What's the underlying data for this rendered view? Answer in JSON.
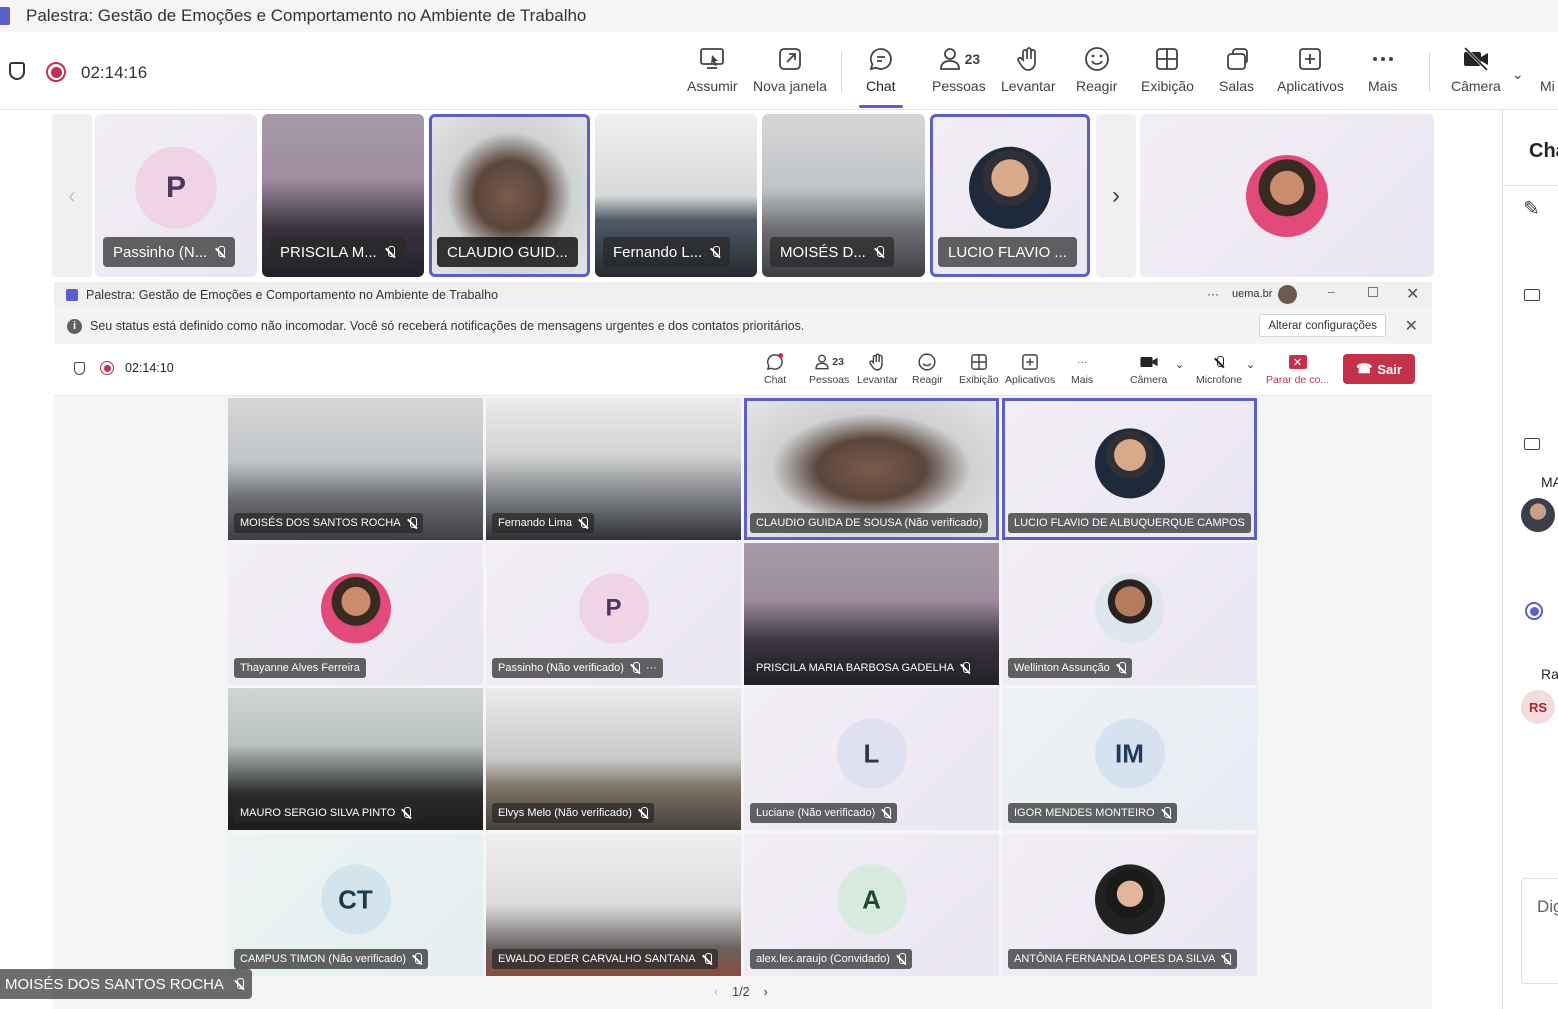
{
  "window": {
    "title": "Palestra: Gestão de Emoções e Comportamento no Ambiente de Trabalho"
  },
  "toolbar": {
    "timer": "02:14:16",
    "assumir": "Assumir",
    "nova_janela": "Nova janela",
    "chat": "Chat",
    "pessoas": "Pessoas",
    "pessoas_count": "23",
    "levantar": "Levantar",
    "reagir": "Reagir",
    "exibicao": "Exibição",
    "salas": "Salas",
    "aplicativos": "Aplicativos",
    "mais": "Mais",
    "camera": "Câmera",
    "microfone_partial": "Mi"
  },
  "strip": [
    {
      "name": "Passinho (N...",
      "initial": "P"
    },
    {
      "name": "PRISCILA M..."
    },
    {
      "name": "CLAUDIO GUID..."
    },
    {
      "name": "Fernando L..."
    },
    {
      "name": "MOISÉS D..."
    },
    {
      "name": "LUCIO FLAVIO ..."
    }
  ],
  "inner": {
    "title": "Palestra: Gestão de Emoções e Comportamento no Ambiente de Trabalho",
    "account": "uema.br",
    "banner": "Seu status está definido como não incomodar. Você só receberá notificações de mensagens urgentes e dos contatos prioritários.",
    "banner_button": "Alterar configurações",
    "timer": "02:14:10",
    "chat": "Chat",
    "pessoas": "Pessoas",
    "pessoas_count": "23",
    "levantar": "Levantar",
    "reagir": "Reagir",
    "exibicao": "Exibição",
    "aplicativos": "Aplicativos",
    "mais": "Mais",
    "camera": "Câmera",
    "microfone": "Microfone",
    "parar": "Parar de co...",
    "sair": "Sair",
    "pager": "1/2"
  },
  "grid": [
    {
      "name": "MOISÉS DOS SANTOS ROCHA"
    },
    {
      "name": "Fernando Lima"
    },
    {
      "name": "CLAUDIO GUIDA DE SOUSA (Não verificado)"
    },
    {
      "name": "LUCIO FLAVIO DE ALBUQUERQUE CAMPOS"
    },
    {
      "name": "Thayanne Alves Ferreira"
    },
    {
      "name": "Passinho (Não verificado)",
      "initial": "P"
    },
    {
      "name": "PRISCILA MARIA BARBOSA GADELHA"
    },
    {
      "name": "Wellinton Assunção"
    },
    {
      "name": "MAURO SERGIO SILVA PINTO"
    },
    {
      "name": "Elvys Melo (Não verificado)"
    },
    {
      "name": "Luciane (Não verificado)",
      "initial": "L"
    },
    {
      "name": "IGOR MENDES MONTEIRO",
      "initial": "IM"
    },
    {
      "name": "CAMPUS TIMON (Não verificado)",
      "initial": "CT"
    },
    {
      "name": "EWALDO EDER CARVALHO SANTANA"
    },
    {
      "name": "alex.lex.araujo (Convidado)",
      "initial": "A"
    },
    {
      "name": "ANTÔNIA FERNANDA LOPES DA SILVA"
    }
  ],
  "right_panel": {
    "title": "Cha",
    "label_ma": "MA",
    "label_ra": "Ra",
    "initials": "RS",
    "input_placeholder": "Dig"
  },
  "self_view": {
    "name": "MOISÉS DOS SANTOS ROCHA"
  }
}
